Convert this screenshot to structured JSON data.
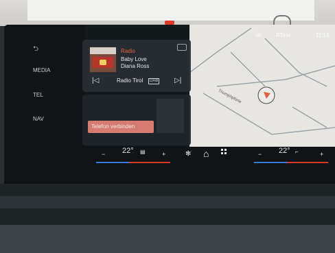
{
  "sidebar": {
    "items": [
      {
        "label": "⮌"
      },
      {
        "label": "MEDIA"
      },
      {
        "label": "TEL"
      },
      {
        "label": "NAV"
      }
    ]
  },
  "status": {
    "station": "RTirol",
    "time": "11:14"
  },
  "media": {
    "source": "Radio",
    "song": "Baby Love",
    "artist": "Diana Ross",
    "station": "Radio Tirol",
    "dab_badge": "DAB",
    "prev_icon": "skip-previous-icon",
    "next_icon": "skip-next-icon"
  },
  "phone": {
    "connect_label": "Telefon verbinden"
  },
  "map": {
    "street": "Triumphpforte"
  },
  "climate": {
    "left_temp": "22°",
    "right_temp": "22°",
    "minus": "−",
    "plus": "+"
  },
  "colors": {
    "accent_red": "#d83a2e",
    "accent_blue": "#3a7bd5",
    "button_pink": "#d77a72"
  }
}
